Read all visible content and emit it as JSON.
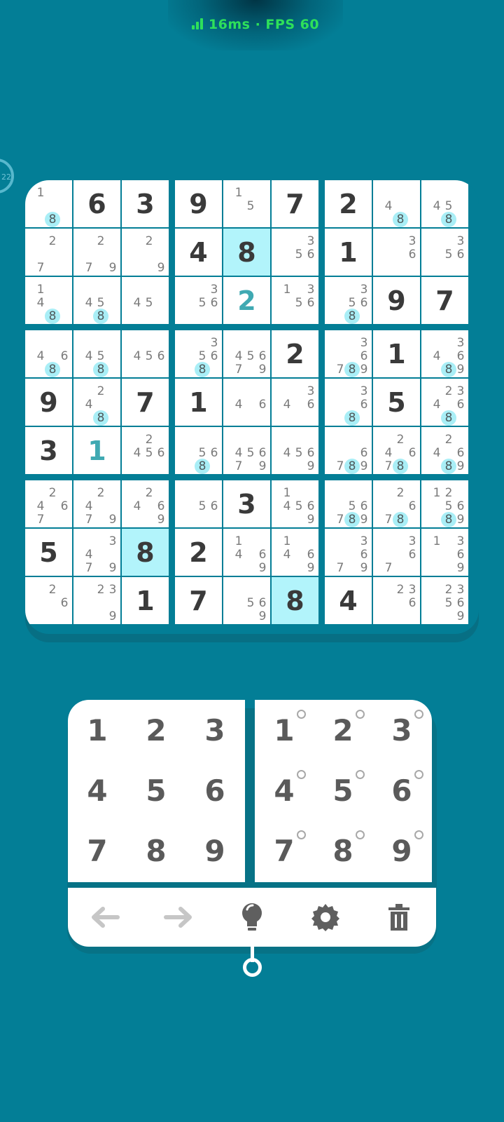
{
  "status_overlay": {
    "text": "16ms · FPS 60",
    "color": "#2ee05a"
  },
  "timer": {
    "text": "22"
  },
  "colors": {
    "background": "#037E96",
    "highlight": "#b2f4fb",
    "note_mark": "#a9eef6",
    "given": "#3a3a3a",
    "user": "#3fa9b2"
  },
  "grid": [
    [
      {
        "v": "",
        "notes": [
          [
            "1",
            false
          ],
          [
            "8",
            true
          ]
        ]
      },
      {
        "v": "6"
      },
      {
        "v": "3"
      },
      {
        "v": "9"
      },
      {
        "v": "",
        "notes": [
          [
            "1",
            false
          ],
          [
            "5",
            false
          ]
        ]
      },
      {
        "v": "7"
      },
      {
        "v": "2"
      },
      {
        "v": "",
        "notes": [
          [
            "4",
            false
          ],
          [
            "8",
            true
          ]
        ]
      },
      {
        "v": "",
        "notes": [
          [
            "4",
            false
          ],
          [
            "5",
            false
          ],
          [
            "8",
            true
          ]
        ]
      }
    ],
    [
      {
        "v": "",
        "notes": [
          [
            "2",
            false
          ],
          [
            "7",
            false
          ]
        ]
      },
      {
        "v": "",
        "notes": [
          [
            "2",
            false
          ],
          [
            "7",
            false
          ],
          [
            "9",
            false
          ]
        ]
      },
      {
        "v": "",
        "notes": [
          [
            "2",
            false
          ],
          [
            "9",
            false
          ]
        ]
      },
      {
        "v": "4"
      },
      {
        "v": "8",
        "hl": true
      },
      {
        "v": "",
        "notes": [
          [
            "3",
            false
          ],
          [
            "5",
            false
          ],
          [
            "6",
            false
          ]
        ]
      },
      {
        "v": "1"
      },
      {
        "v": "",
        "notes": [
          [
            "3",
            false
          ],
          [
            "6",
            false
          ]
        ]
      },
      {
        "v": "",
        "notes": [
          [
            "3",
            false
          ],
          [
            "5",
            false
          ],
          [
            "6",
            false
          ]
        ]
      }
    ],
    [
      {
        "v": "",
        "notes": [
          [
            "1",
            false
          ],
          [
            "4",
            false
          ],
          [
            "8",
            true
          ]
        ]
      },
      {
        "v": "",
        "notes": [
          [
            "4",
            false
          ],
          [
            "5",
            false
          ],
          [
            "8",
            true
          ]
        ]
      },
      {
        "v": "",
        "notes": [
          [
            "4",
            false
          ],
          [
            "5",
            false
          ]
        ]
      },
      {
        "v": "",
        "notes": [
          [
            "3",
            false
          ],
          [
            "5",
            false
          ],
          [
            "6",
            false
          ]
        ]
      },
      {
        "v": "2",
        "user": true
      },
      {
        "v": "",
        "notes": [
          [
            "1",
            false
          ],
          [
            "3",
            false
          ],
          [
            "5",
            false
          ],
          [
            "6",
            false
          ]
        ]
      },
      {
        "v": "",
        "notes": [
          [
            "3",
            false
          ],
          [
            "5",
            false
          ],
          [
            "6",
            false
          ],
          [
            "8",
            true
          ]
        ]
      },
      {
        "v": "9"
      },
      {
        "v": "7"
      }
    ],
    [
      {
        "v": "",
        "notes": [
          [
            "4",
            false
          ],
          [
            "6",
            false
          ],
          [
            "8",
            true
          ]
        ]
      },
      {
        "v": "",
        "notes": [
          [
            "4",
            false
          ],
          [
            "5",
            false
          ],
          [
            "8",
            true
          ]
        ]
      },
      {
        "v": "",
        "notes": [
          [
            "4",
            false
          ],
          [
            "5",
            false
          ],
          [
            "6",
            false
          ]
        ]
      },
      {
        "v": "",
        "notes": [
          [
            "3",
            false
          ],
          [
            "5",
            false
          ],
          [
            "6",
            false
          ],
          [
            "8",
            true
          ]
        ]
      },
      {
        "v": "",
        "notes": [
          [
            "4",
            false
          ],
          [
            "5",
            false
          ],
          [
            "6",
            false
          ],
          [
            "7",
            false
          ],
          [
            "9",
            false
          ]
        ]
      },
      {
        "v": "2"
      },
      {
        "v": "",
        "notes": [
          [
            "3",
            false
          ],
          [
            "6",
            false
          ],
          [
            "7",
            false
          ],
          [
            "8",
            true
          ],
          [
            "9",
            false
          ]
        ]
      },
      {
        "v": "1"
      },
      {
        "v": "",
        "notes": [
          [
            "3",
            false
          ],
          [
            "4",
            false
          ],
          [
            "6",
            false
          ],
          [
            "8",
            true
          ],
          [
            "9",
            false
          ]
        ]
      }
    ],
    [
      {
        "v": "9"
      },
      {
        "v": "",
        "notes": [
          [
            "2",
            false
          ],
          [
            "4",
            false
          ],
          [
            "8",
            true
          ]
        ]
      },
      {
        "v": "7"
      },
      {
        "v": "1"
      },
      {
        "v": "",
        "notes": [
          [
            "4",
            false
          ],
          [
            "6",
            false
          ]
        ]
      },
      {
        "v": "",
        "notes": [
          [
            "3",
            false
          ],
          [
            "4",
            false
          ],
          [
            "6",
            false
          ]
        ]
      },
      {
        "v": "",
        "notes": [
          [
            "3",
            false
          ],
          [
            "6",
            false
          ],
          [
            "8",
            true
          ]
        ]
      },
      {
        "v": "5"
      },
      {
        "v": "",
        "notes": [
          [
            "2",
            false
          ],
          [
            "3",
            false
          ],
          [
            "4",
            false
          ],
          [
            "6",
            false
          ],
          [
            "8",
            true
          ]
        ]
      }
    ],
    [
      {
        "v": "3"
      },
      {
        "v": "1",
        "user": true
      },
      {
        "v": "",
        "notes": [
          [
            "2",
            false
          ],
          [
            "4",
            false
          ],
          [
            "5",
            false
          ],
          [
            "6",
            false
          ]
        ]
      },
      {
        "v": "",
        "notes": [
          [
            "5",
            false
          ],
          [
            "6",
            false
          ],
          [
            "8",
            true
          ]
        ]
      },
      {
        "v": "",
        "notes": [
          [
            "4",
            false
          ],
          [
            "5",
            false
          ],
          [
            "6",
            false
          ],
          [
            "7",
            false
          ],
          [
            "9",
            false
          ]
        ]
      },
      {
        "v": "",
        "notes": [
          [
            "4",
            false
          ],
          [
            "5",
            false
          ],
          [
            "6",
            false
          ],
          [
            "9",
            false
          ]
        ]
      },
      {
        "v": "",
        "notes": [
          [
            "6",
            false
          ],
          [
            "7",
            false
          ],
          [
            "8",
            true
          ],
          [
            "9",
            false
          ]
        ]
      },
      {
        "v": "",
        "notes": [
          [
            "2",
            false
          ],
          [
            "4",
            false
          ],
          [
            "6",
            false
          ],
          [
            "7",
            false
          ],
          [
            "8",
            true
          ]
        ]
      },
      {
        "v": "",
        "notes": [
          [
            "2",
            false
          ],
          [
            "4",
            false
          ],
          [
            "6",
            false
          ],
          [
            "8",
            true
          ],
          [
            "9",
            false
          ]
        ]
      }
    ],
    [
      {
        "v": "",
        "notes": [
          [
            "2",
            false
          ],
          [
            "4",
            false
          ],
          [
            "6",
            false
          ],
          [
            "7",
            false
          ]
        ]
      },
      {
        "v": "",
        "notes": [
          [
            "2",
            false
          ],
          [
            "4",
            false
          ],
          [
            "7",
            false
          ],
          [
            "9",
            false
          ]
        ]
      },
      {
        "v": "",
        "notes": [
          [
            "2",
            false
          ],
          [
            "4",
            false
          ],
          [
            "6",
            false
          ],
          [
            "9",
            false
          ]
        ]
      },
      {
        "v": "",
        "notes": [
          [
            "5",
            false
          ],
          [
            "6",
            false
          ]
        ]
      },
      {
        "v": "3"
      },
      {
        "v": "",
        "notes": [
          [
            "1",
            false
          ],
          [
            "4",
            false
          ],
          [
            "5",
            false
          ],
          [
            "6",
            false
          ],
          [
            "9",
            false
          ]
        ]
      },
      {
        "v": "",
        "notes": [
          [
            "5",
            false
          ],
          [
            "6",
            false
          ],
          [
            "7",
            false
          ],
          [
            "8",
            true
          ],
          [
            "9",
            false
          ]
        ]
      },
      {
        "v": "",
        "notes": [
          [
            "2",
            false
          ],
          [
            "6",
            false
          ],
          [
            "7",
            false
          ],
          [
            "8",
            true
          ]
        ]
      },
      {
        "v": "",
        "notes": [
          [
            "1",
            false
          ],
          [
            "2",
            false
          ],
          [
            "5",
            false
          ],
          [
            "6",
            false
          ],
          [
            "8",
            true
          ],
          [
            "9",
            false
          ]
        ]
      }
    ],
    [
      {
        "v": "5"
      },
      {
        "v": "",
        "notes": [
          [
            "3",
            false
          ],
          [
            "4",
            false
          ],
          [
            "7",
            false
          ],
          [
            "9",
            false
          ]
        ]
      },
      {
        "v": "8",
        "hl": true
      },
      {
        "v": "2"
      },
      {
        "v": "",
        "notes": [
          [
            "1",
            false
          ],
          [
            "4",
            false
          ],
          [
            "6",
            false
          ],
          [
            "9",
            false
          ]
        ]
      },
      {
        "v": "",
        "notes": [
          [
            "1",
            false
          ],
          [
            "4",
            false
          ],
          [
            "6",
            false
          ],
          [
            "9",
            false
          ]
        ]
      },
      {
        "v": "",
        "notes": [
          [
            "3",
            false
          ],
          [
            "6",
            false
          ],
          [
            "7",
            false
          ],
          [
            "9",
            false
          ]
        ]
      },
      {
        "v": "",
        "notes": [
          [
            "3",
            false
          ],
          [
            "6",
            false
          ],
          [
            "7",
            false
          ]
        ]
      },
      {
        "v": "",
        "notes": [
          [
            "1",
            false
          ],
          [
            "3",
            false
          ],
          [
            "6",
            false
          ],
          [
            "9",
            false
          ]
        ]
      }
    ],
    [
      {
        "v": "",
        "notes": [
          [
            "2",
            false
          ],
          [
            "6",
            false
          ]
        ]
      },
      {
        "v": "",
        "notes": [
          [
            "2",
            false
          ],
          [
            "3",
            false
          ],
          [
            "9",
            false
          ]
        ]
      },
      {
        "v": "1"
      },
      {
        "v": "7"
      },
      {
        "v": "",
        "notes": [
          [
            "5",
            false
          ],
          [
            "6",
            false
          ],
          [
            "9",
            false
          ]
        ]
      },
      {
        "v": "8",
        "hl": true
      },
      {
        "v": "4"
      },
      {
        "v": "",
        "notes": [
          [
            "2",
            false
          ],
          [
            "3",
            false
          ],
          [
            "6",
            false
          ]
        ]
      },
      {
        "v": "",
        "notes": [
          [
            "2",
            false
          ],
          [
            "3",
            false
          ],
          [
            "5",
            false
          ],
          [
            "6",
            false
          ],
          [
            "9",
            false
          ]
        ]
      }
    ]
  ],
  "number_pad": {
    "keys": [
      "1",
      "2",
      "3",
      "4",
      "5",
      "6",
      "7",
      "8",
      "9"
    ]
  },
  "notes_pad": {
    "keys": [
      "1",
      "2",
      "3",
      "4",
      "5",
      "6",
      "7",
      "8",
      "9"
    ]
  },
  "toolbar": {
    "tools": [
      {
        "name": "undo-button",
        "icon": "arrow-left-icon",
        "enabled": false
      },
      {
        "name": "redo-button",
        "icon": "arrow-right-icon",
        "enabled": false
      },
      {
        "name": "hint-button",
        "icon": "lightbulb-icon",
        "enabled": true
      },
      {
        "name": "settings-button",
        "icon": "gear-icon",
        "enabled": true
      },
      {
        "name": "delete-button",
        "icon": "trash-icon",
        "enabled": true
      }
    ]
  }
}
